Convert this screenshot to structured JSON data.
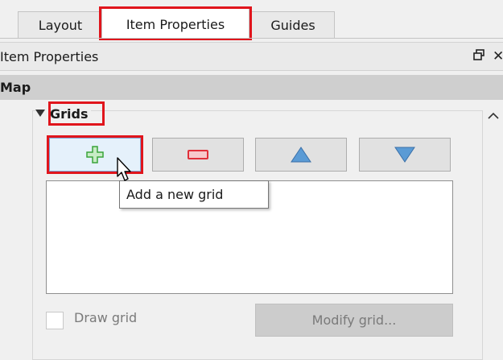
{
  "tabs": [
    {
      "label": "Layout"
    },
    {
      "label": "Item Properties"
    },
    {
      "label": "Guides"
    }
  ],
  "dock": {
    "title": "Item Properties",
    "float_icon": "float-icon",
    "close_icon": "close-icon"
  },
  "section": {
    "title": "Map"
  },
  "grids": {
    "title": "Grids",
    "expander_icon": "triangle-down-icon",
    "buttons": [
      {
        "icon": "plus-icon",
        "color": "#3aa43a"
      },
      {
        "icon": "minus-icon",
        "color": "#e0303a"
      },
      {
        "icon": "arrow-up-icon",
        "color": "#4a90d9"
      },
      {
        "icon": "arrow-down-icon",
        "color": "#4a90d9"
      }
    ],
    "tooltip": "Add a new grid",
    "draw_grid_label": "Draw grid",
    "modify_button": "Modify grid..."
  },
  "colors": {
    "highlight": "#e0151c"
  }
}
